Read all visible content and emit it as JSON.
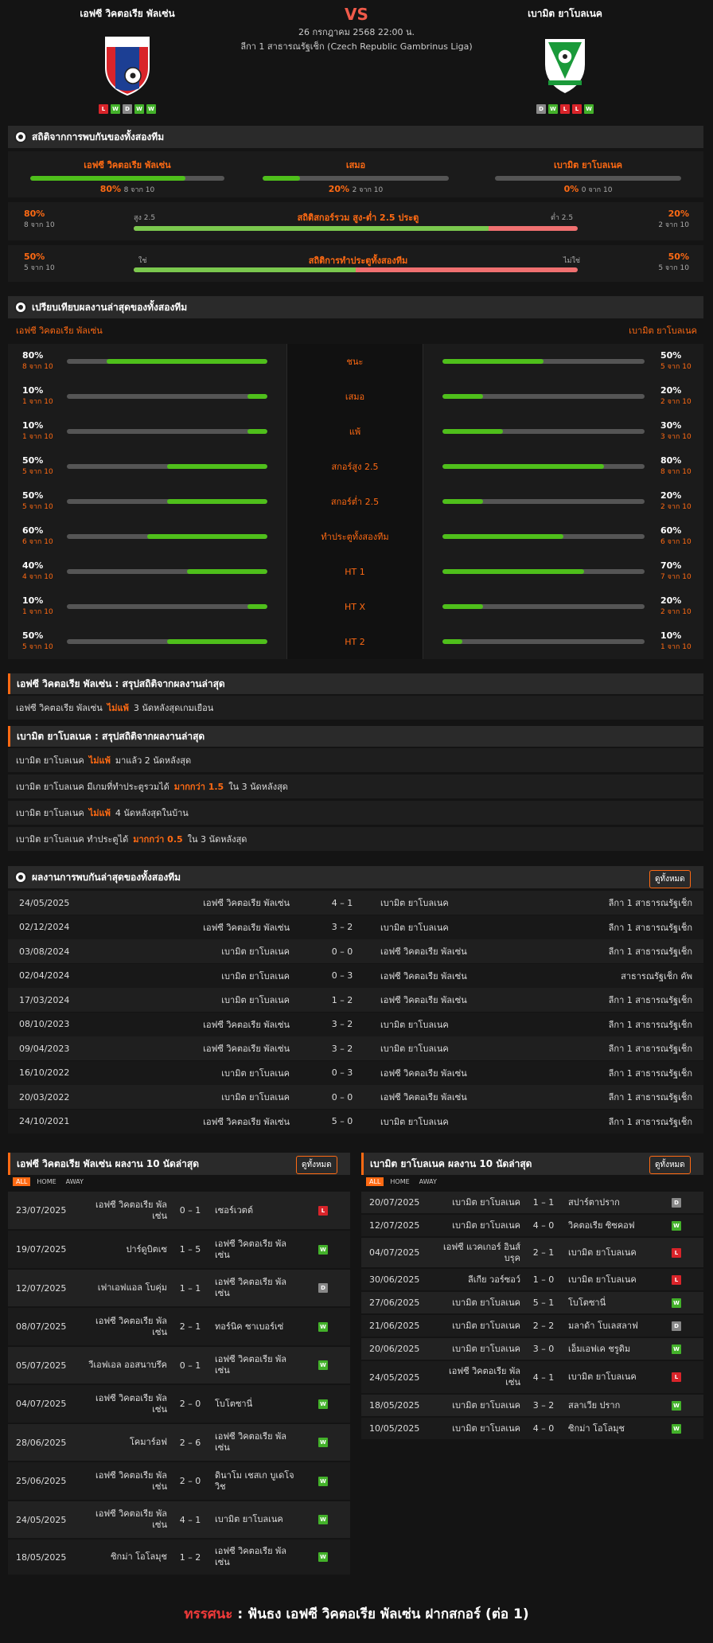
{
  "match": {
    "home": "เอฟซี วิคตอเรีย พัลเซ่น",
    "away": "เบามิต ยาโบลเนค",
    "vs": "VS",
    "date": "26 กรกฎาคม 2568 22:00 น.",
    "league": "ลีกา 1 สาธารณรัฐเช็ก (Czech Republic Gambrinus Liga)",
    "home_form": [
      "L",
      "W",
      "D",
      "W",
      "W"
    ],
    "away_form": [
      "D",
      "W",
      "L",
      "L",
      "W"
    ]
  },
  "h2h_stats": {
    "title": "สถิติจากการพบกันของทั้งสองทีม",
    "home_label": "เอฟซี วิคตอเรีย พัลเซ่น",
    "home_pct": "80%",
    "home_sub": "8 จาก 10",
    "draw_label": "เสมอ",
    "draw_pct": "20%",
    "draw_sub": "2 จาก 10",
    "away_label": "เบามิต ยาโบลเนค",
    "away_pct": "0%",
    "away_sub": "0 จาก 10",
    "home_frac": 0.8,
    "draw_frac": 0.2,
    "away_frac": 0,
    "ou": {
      "title": "สถิติสกอร์รวม สูง-ต่ำ 2.5 ประตู",
      "left_pct": "80%",
      "left_sub": "8 จาก 10",
      "right_pct": "20%",
      "right_sub": "2 จาก 10",
      "left_label": "สูง 2.5",
      "right_label": "ต่ำ 2.5",
      "frac": 0.8
    },
    "btts": {
      "title": "สถิติการทำประตูทั้งสองทีม",
      "left_pct": "50%",
      "left_sub": "5 จาก 10",
      "right_pct": "50%",
      "right_sub": "5 จาก 10",
      "left_label": "ใช่",
      "right_label": "ไม่ใช่",
      "frac": 0.5
    }
  },
  "compare": {
    "title": "เปรียบเทียบผลงานล่าสุดของทั้งสองทีม",
    "home": "เอฟซี วิคตอเรีย พัลเซ่น",
    "away": "เบามิต ยาโบลเนค",
    "rows": [
      {
        "label": "ชนะ",
        "hp": "80%",
        "hs": "8 จาก 10",
        "hf": 0.8,
        "ap": "50%",
        "as": "5 จาก 10",
        "af": 0.5
      },
      {
        "label": "เสมอ",
        "hp": "10%",
        "hs": "1 จาก 10",
        "hf": 0.1,
        "ap": "20%",
        "as": "2 จาก 10",
        "af": 0.2
      },
      {
        "label": "แพ้",
        "hp": "10%",
        "hs": "1 จาก 10",
        "hf": 0.1,
        "ap": "30%",
        "as": "3 จาก 10",
        "af": 0.3
      },
      {
        "label": "สกอร์สูง 2.5",
        "hp": "50%",
        "hs": "5 จาก 10",
        "hf": 0.5,
        "ap": "80%",
        "as": "8 จาก 10",
        "af": 0.8
      },
      {
        "label": "สกอร์ต่ำ 2.5",
        "hp": "50%",
        "hs": "5 จาก 10",
        "hf": 0.5,
        "ap": "20%",
        "as": "2 จาก 10",
        "af": 0.2
      },
      {
        "label": "ทำประตูทั้งสองทีม",
        "hp": "60%",
        "hs": "6 จาก 10",
        "hf": 0.6,
        "ap": "60%",
        "as": "6 จาก 10",
        "af": 0.6
      },
      {
        "label": "HT 1",
        "hp": "40%",
        "hs": "4 จาก 10",
        "hf": 0.4,
        "ap": "70%",
        "as": "7 จาก 10",
        "af": 0.7
      },
      {
        "label": "HT X",
        "hp": "10%",
        "hs": "1 จาก 10",
        "hf": 0.1,
        "ap": "20%",
        "as": "2 จาก 10",
        "af": 0.2
      },
      {
        "label": "HT 2",
        "hp": "50%",
        "hs": "5 จาก 10",
        "hf": 0.5,
        "ap": "10%",
        "as": "1 จาก 10",
        "af": 0.1
      }
    ]
  },
  "summary_home": {
    "title": "เอฟซี วิคตอเรีย พัลเซ่น : สรุปสถิติจากผลงานล่าสุด",
    "lines": [
      {
        "a": "เอฟซี วิคตอเรีย พัลเซ่น",
        "b": "ไม่แพ้",
        "c": "3  นัดหลังสุดเกมเยือน"
      }
    ]
  },
  "summary_away": {
    "title": "เบามิต ยาโบลเนค : สรุปสถิติจากผลงานล่าสุด",
    "lines": [
      {
        "a": "เบามิต ยาโบลเนค",
        "b": "ไม่แพ้",
        "c": "มาแล้ว 2 นัดหลังสุด"
      },
      {
        "a": "เบามิต ยาโบลเนค  มีเกมที่ทำประตูรวมได้",
        "b": "มากกว่า 1.5",
        "c": "ใน 3 นัดหลังสุด"
      },
      {
        "a": "เบามิต ยาโบลเนค",
        "b": "ไม่แพ้",
        "c": "4  นัดหลังสุดในบ้าน"
      },
      {
        "a": "เบามิต ยาโบลเนค  ทำประตูได้",
        "b": "มากกว่า  0.5",
        "c": "ใน 3 นัดหลังสุด"
      }
    ]
  },
  "h2h_results": {
    "title": "ผลงานการพบกันล่าสุดของทั้งสองทีม",
    "view_all": "ดูทั้งหมด",
    "rows": [
      [
        "24/05/2025",
        "เอฟซี วิคตอเรีย พัลเซ่น",
        "4 – 1",
        "เบามิต ยาโบลเนค",
        "ลีกา 1 สาธารณรัฐเช็ก"
      ],
      [
        "02/12/2024",
        "เอฟซี วิคตอเรีย พัลเซ่น",
        "3 – 2",
        "เบามิต ยาโบลเนค",
        "ลีกา 1 สาธารณรัฐเช็ก"
      ],
      [
        "03/08/2024",
        "เบามิต ยาโบลเนค",
        "0 – 0",
        "เอฟซี วิคตอเรีย พัลเซ่น",
        "ลีกา 1 สาธารณรัฐเช็ก"
      ],
      [
        "02/04/2024",
        "เบามิต ยาโบลเนค",
        "0 – 3",
        "เอฟซี วิคตอเรีย พัลเซ่น",
        "สาธารณรัฐเช็ก คัพ"
      ],
      [
        "17/03/2024",
        "เบามิต ยาโบลเนค",
        "1 – 2",
        "เอฟซี วิคตอเรีย พัลเซ่น",
        "ลีกา 1 สาธารณรัฐเช็ก"
      ],
      [
        "08/10/2023",
        "เอฟซี วิคตอเรีย พัลเซ่น",
        "3 – 2",
        "เบามิต ยาโบลเนค",
        "ลีกา 1 สาธารณรัฐเช็ก"
      ],
      [
        "09/04/2023",
        "เอฟซี วิคตอเรีย พัลเซ่น",
        "3 – 2",
        "เบามิต ยาโบลเนค",
        "ลีกา 1 สาธารณรัฐเช็ก"
      ],
      [
        "16/10/2022",
        "เบามิต ยาโบลเนค",
        "0 – 3",
        "เอฟซี วิคตอเรีย พัลเซ่น",
        "ลีกา 1 สาธารณรัฐเช็ก"
      ],
      [
        "20/03/2022",
        "เบามิต ยาโบลเนค",
        "0 – 0",
        "เอฟซี วิคตอเรีย พัลเซ่น",
        "ลีกา 1 สาธารณรัฐเช็ก"
      ],
      [
        "24/10/2021",
        "เอฟซี วิคตอเรีย พัลเซ่น",
        "5 – 0",
        "เบามิต ยาโบลเนค",
        "ลีกา 1 สาธารณรัฐเช็ก"
      ]
    ]
  },
  "home_last": {
    "title": "เอฟซี วิคตอเรีย พัลเซ่น ผลงาน 10 นัดล่าสุด",
    "view_all": "ดูทั้งหมด",
    "filters": [
      "ALL",
      "HOME",
      "AWAY"
    ],
    "rows": [
      [
        "23/07/2025",
        "เอฟซี วิคตอเรีย พัลเซ่น",
        "0 – 1",
        "เซอร์เวตต์",
        "L"
      ],
      [
        "19/07/2025",
        "ปาร์ดูบิตเซ",
        "1 – 5",
        "เอฟซี วิคตอเรีย พัลเซ่น",
        "W"
      ],
      [
        "12/07/2025",
        "เฟาเอฟแอล โบคุ่ม",
        "1 – 1",
        "เอฟซี วิคตอเรีย พัลเซ่น",
        "D"
      ],
      [
        "08/07/2025",
        "เอฟซี วิคตอเรีย พัลเซ่น",
        "2 – 1",
        "ทอร์นิค ซาเบอร์เซ่",
        "W"
      ],
      [
        "05/07/2025",
        "วีเอฟเอล ออสนาบรึค",
        "0 – 1",
        "เอฟซี วิคตอเรีย พัลเซ่น",
        "W"
      ],
      [
        "04/07/2025",
        "เอฟซี วิคตอเรีย พัลเซ่น",
        "2 – 0",
        "โบโตซานี่",
        "W"
      ],
      [
        "28/06/2025",
        "โคมาร์อฟ",
        "2 – 6",
        "เอฟซี วิคตอเรีย พัลเซ่น",
        "W"
      ],
      [
        "25/06/2025",
        "เอฟซี วิคตอเรีย พัลเซ่น",
        "2 – 0",
        "ดินาโม เชสเก บูเดโจวิช",
        "W"
      ],
      [
        "24/05/2025",
        "เอฟซี วิคตอเรีย พัลเซ่น",
        "4 – 1",
        "เบามิต ยาโบลเนค",
        "W"
      ],
      [
        "18/05/2025",
        "ซิกม่า โอโลมุช",
        "1 – 2",
        "เอฟซี วิคตอเรีย พัลเซ่น",
        "W"
      ]
    ]
  },
  "away_last": {
    "title": "เบามิต ยาโบลเนค ผลงาน 10 นัดล่าสุด",
    "view_all": "ดูทั้งหมด",
    "filters": [
      "ALL",
      "HOME",
      "AWAY"
    ],
    "rows": [
      [
        "20/07/2025",
        "เบามิต ยาโบลเนค",
        "1 – 1",
        "สปาร์ตาปราก",
        "D"
      ],
      [
        "12/07/2025",
        "เบามิต ยาโบลเนค",
        "4 – 0",
        "วิคตอเรีย ซิซคอฟ",
        "W"
      ],
      [
        "04/07/2025",
        "เอฟซี แวคเกอร์ อินส์บรุค",
        "2 – 1",
        "เบามิต ยาโบลเนค",
        "L"
      ],
      [
        "30/06/2025",
        "ลีเกีย วอร์ซอว์",
        "1 – 0",
        "เบามิต ยาโบลเนค",
        "L"
      ],
      [
        "27/06/2025",
        "เบามิต ยาโบลเนค",
        "5 – 1",
        "โบโตซานี่",
        "W"
      ],
      [
        "21/06/2025",
        "เบามิต ยาโบลเนค",
        "2 – 2",
        "มลาด้า โบเลสลาฟ",
        "D"
      ],
      [
        "20/06/2025",
        "เบามิต ยาโบลเนค",
        "3 – 0",
        "เอ็มเอฟเค ชรูดิม",
        "W"
      ],
      [
        "24/05/2025",
        "เอฟซี วิคตอเรีย พัลเซ่น",
        "4 – 1",
        "เบามิต ยาโบลเนค",
        "L"
      ],
      [
        "18/05/2025",
        "เบามิต ยาโบลเนค",
        "3 – 2",
        "สลาเวีย ปราก",
        "W"
      ],
      [
        "10/05/2025",
        "เบามิต ยาโบลเนค",
        "4 – 0",
        "ซิกม่า โอโลมุช",
        "W"
      ]
    ]
  },
  "prediction": {
    "label": "ทรรศนะ",
    "sep": ":",
    "text": "ฟันธง เอฟซี วิคตอเรีย พัลเซ่น ฝากสกอร์ (ต่อ 1)"
  },
  "colors": {
    "accent": "#ff6a13",
    "win": "#43b12a",
    "loss": "#d9242a",
    "draw": "#888888",
    "bar": "#4fbf1b"
  }
}
